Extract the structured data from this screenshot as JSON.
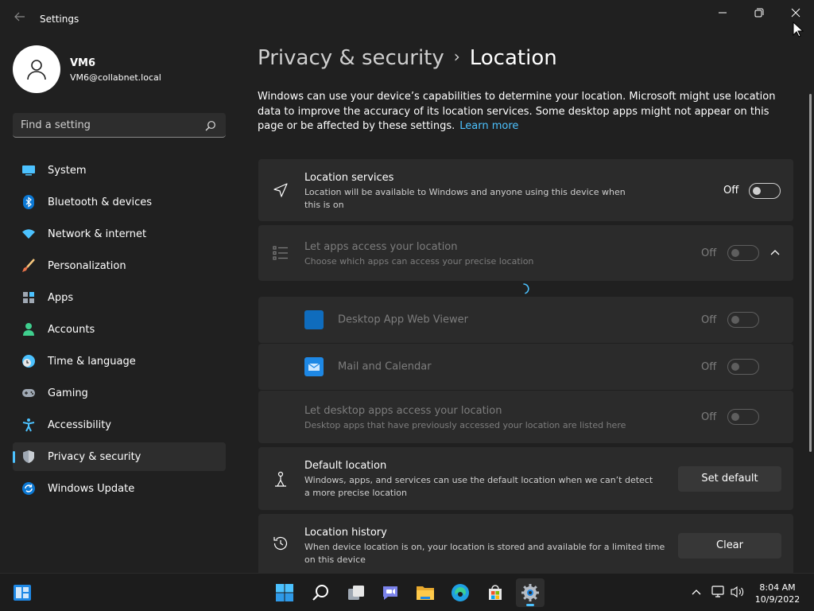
{
  "window": {
    "title": "Settings"
  },
  "user": {
    "name": "VM6",
    "email": "VM6@collabnet.local"
  },
  "search": {
    "placeholder": "Find a setting"
  },
  "nav": {
    "items": [
      {
        "label": "System",
        "icon": "system-icon"
      },
      {
        "label": "Bluetooth & devices",
        "icon": "bluetooth-icon"
      },
      {
        "label": "Network & internet",
        "icon": "wifi-icon"
      },
      {
        "label": "Personalization",
        "icon": "brush-icon"
      },
      {
        "label": "Apps",
        "icon": "apps-icon"
      },
      {
        "label": "Accounts",
        "icon": "accounts-icon"
      },
      {
        "label": "Time & language",
        "icon": "clock-globe-icon"
      },
      {
        "label": "Gaming",
        "icon": "gamepad-icon"
      },
      {
        "label": "Accessibility",
        "icon": "accessibility-icon"
      },
      {
        "label": "Privacy & security",
        "icon": "shield-icon",
        "active": true
      },
      {
        "label": "Windows Update",
        "icon": "update-icon"
      }
    ]
  },
  "header": {
    "parent": "Privacy & security",
    "separator": "›",
    "current": "Location"
  },
  "description": {
    "text": "Windows can use your device’s capabilities to determine your location. Microsoft might use location data to improve the accuracy of its location services. Some desktop apps might not appear on this page or be affected by these settings.",
    "link": "Learn more"
  },
  "settings": {
    "location_services": {
      "title": "Location services",
      "subtitle": "Location will be available to Windows and anyone using this device when this is on",
      "state": "Off"
    },
    "let_apps": {
      "title": "Let apps access your location",
      "subtitle": "Choose which apps can access your precise location",
      "state": "Off"
    },
    "apps": [
      {
        "name": "Desktop App Web Viewer",
        "state": "Off",
        "color": "#0f6cbd"
      },
      {
        "name": "Mail and Calendar",
        "state": "Off",
        "color": "#1e88e5"
      }
    ],
    "desktop_apps": {
      "title": "Let desktop apps access your location",
      "subtitle": "Desktop apps that have previously accessed your location are listed here",
      "state": "Off"
    },
    "default_location": {
      "title": "Default location",
      "subtitle": "Windows, apps, and services can use the default location when we can’t detect a more precise location",
      "button": "Set default"
    },
    "location_history": {
      "title": "Location history",
      "subtitle": "When device location is on, your location is stored and available for a limited time on this device",
      "button": "Clear"
    }
  },
  "taskbar": {
    "time": "8:04 AM",
    "date": "10/9/2022",
    "accent": "#4cc2ff"
  }
}
